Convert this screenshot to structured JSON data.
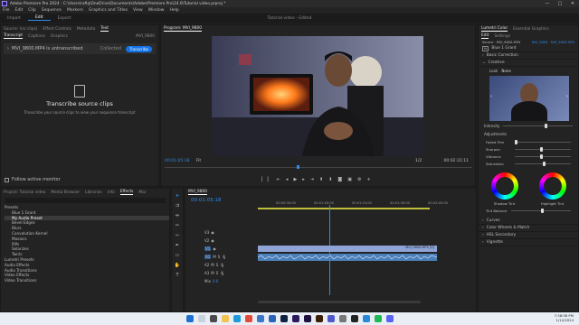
{
  "window": {
    "title": "Adobe Premiere Pro 2024 - C:\\Users\\rafiq\\OneDrive\\Documents\\Adobe\\Premiere Pro\\24.0\\Tutorial video.prproj *",
    "min": "—",
    "max": "□",
    "close": "✕"
  },
  "menu": [
    "File",
    "Edit",
    "Clip",
    "Sequence",
    "Markers",
    "Graphics and Titles",
    "View",
    "Window",
    "Help"
  ],
  "workspace": {
    "tabs": [
      "Import",
      "Edit",
      "Export"
    ],
    "active": 1,
    "project": "Tutorial video",
    "status": "- Edited"
  },
  "source_panel": {
    "tabs": [
      "Source: (no clips)",
      "Effect Controls",
      "Metadata",
      "Text"
    ],
    "seq_label": "MVI_9800",
    "subtabs": [
      "Transcript",
      "Captions",
      "Graphics"
    ],
    "clip_row": {
      "name": "MVI_9800.MP4 is untranscribed",
      "status": "Collected",
      "button": "Transcribe"
    },
    "heading": "Transcribe source clips",
    "body": "Transcribe your source clips to view your sequence transcript",
    "follow": "Follow active monitor"
  },
  "program": {
    "label": "Program: MVI_9800",
    "timecode_left": "00:01:05:18",
    "fit": "Fit",
    "ratio": "1/2",
    "timecode_right": "00:02:31:11"
  },
  "project_panel": {
    "tabs": [
      "Project: Tutorial video",
      "Media Browser",
      "Libraries",
      "Info",
      "Effects",
      "Mar"
    ],
    "items": [
      "Presets",
      "Blue 1 Grant",
      "My Audio Preset",
      "Bevel Edges",
      "Blurs",
      "Convolution Kernel",
      "Mosaics",
      "PiPs",
      "Solarizes",
      "Twirls",
      "Lumetri Presets",
      "Audio Effects",
      "Audio Transitions",
      "Video Effects",
      "Video Transitions"
    ]
  },
  "timeline": {
    "seq": "MVI_9800",
    "timecode": "00:01:05:18",
    "ruler": [
      "00:00:30:00",
      "00:01:00:00",
      "00:01:15:00",
      "00:01:30:00",
      "00:02:00:00"
    ],
    "video_tracks": [
      "V3",
      "V2",
      "V1"
    ],
    "audio_tracks": [
      "A1",
      "A2",
      "A3"
    ],
    "mix": "Mix",
    "mix_value": "0.0",
    "clip_label": "MVI_9800.MP4 [V]"
  },
  "lumetri": {
    "tabs": [
      "Lumetri Color",
      "Essential Graphics"
    ],
    "subtabs": [
      "Edit",
      "Settings"
    ],
    "source": "Source · MVI_9800.MP4",
    "seq": "MVI_9800 · MVI_9800.MP4",
    "lut_label": "Blue 1 Grant",
    "sections": [
      "Basic Correction",
      "Creative"
    ],
    "look": "Look",
    "look_value": "None",
    "intensity": "Intensity",
    "adjustments": "Adjustments",
    "sliders": [
      "Faded Film",
      "Sharpen",
      "Vibrance",
      "Saturation"
    ],
    "wheel_labels": [
      "Shadow Tint",
      "Highlight Tint"
    ],
    "tint_balance": "Tint Balance",
    "bottom_sections": [
      "Curves",
      "Color Wheels & Match",
      "HSL Secondary",
      "Vignette"
    ],
    "accent": "#2d8ceb"
  },
  "taskbar": {
    "time": "7:38:58 PM",
    "date": "1/12/2024"
  }
}
